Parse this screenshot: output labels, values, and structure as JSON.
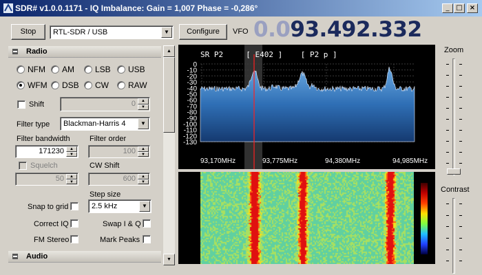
{
  "window": {
    "title": "SDR# v1.0.0.1171 - IQ Imbalance: Gain = 1,007 Phase = -0,286°"
  },
  "toolbar": {
    "stop_label": "Stop",
    "source_value": "RTL-SDR / USB",
    "configure_label": "Configure",
    "vfo_label": "VFO",
    "frequency_dim": "0.0",
    "frequency_main": "93.492.332"
  },
  "radio": {
    "section_title": "Radio",
    "modes": [
      {
        "label": "NFM",
        "selected": false
      },
      {
        "label": "AM",
        "selected": false
      },
      {
        "label": "LSB",
        "selected": false
      },
      {
        "label": "USB",
        "selected": false
      },
      {
        "label": "WFM",
        "selected": true
      },
      {
        "label": "DSB",
        "selected": false
      },
      {
        "label": "CW",
        "selected": false
      },
      {
        "label": "RAW",
        "selected": false
      }
    ],
    "shift_label": "Shift",
    "shift_value": "0",
    "filter_type_label": "Filter type",
    "filter_type_value": "Blackman-Harris 4",
    "filter_bandwidth_label": "Filter bandwidth",
    "filter_bandwidth_value": "171230",
    "filter_order_label": "Filter order",
    "filter_order_value": "100",
    "squelch_label": "Squelch",
    "squelch_value": "50",
    "cw_shift_label": "CW Shift",
    "cw_shift_value": "600",
    "step_size_label": "Step size",
    "step_size_value": "2.5 kHz",
    "snap_label": "Snap to grid",
    "correct_iq_label": "Correct IQ",
    "swap_iq_label": "Swap I & Q",
    "fm_stereo_label": "FM Stereo",
    "mark_peaks_label": "Mark Peaks"
  },
  "audio": {
    "section_title": "Audio"
  },
  "spectrum": {
    "rds_text": "SR P2     [ E402 ]    [ P2 p ]",
    "y_ticks": [
      "0",
      "-10",
      "-20",
      "-30",
      "-40",
      "-50",
      "-60",
      "-70",
      "-80",
      "-90",
      "-100",
      "-110",
      "-120",
      "-130"
    ],
    "x_ticks": [
      "93,170MHz",
      "93,775MHz",
      "94,380MHz",
      "94,985MHz"
    ]
  },
  "zoom_label": "Zoom",
  "contrast_label": "Contrast",
  "colors": {
    "accent": "#0a246a",
    "spectrum_fill": "#2e78c8",
    "tuned_line": "#ff2020"
  }
}
